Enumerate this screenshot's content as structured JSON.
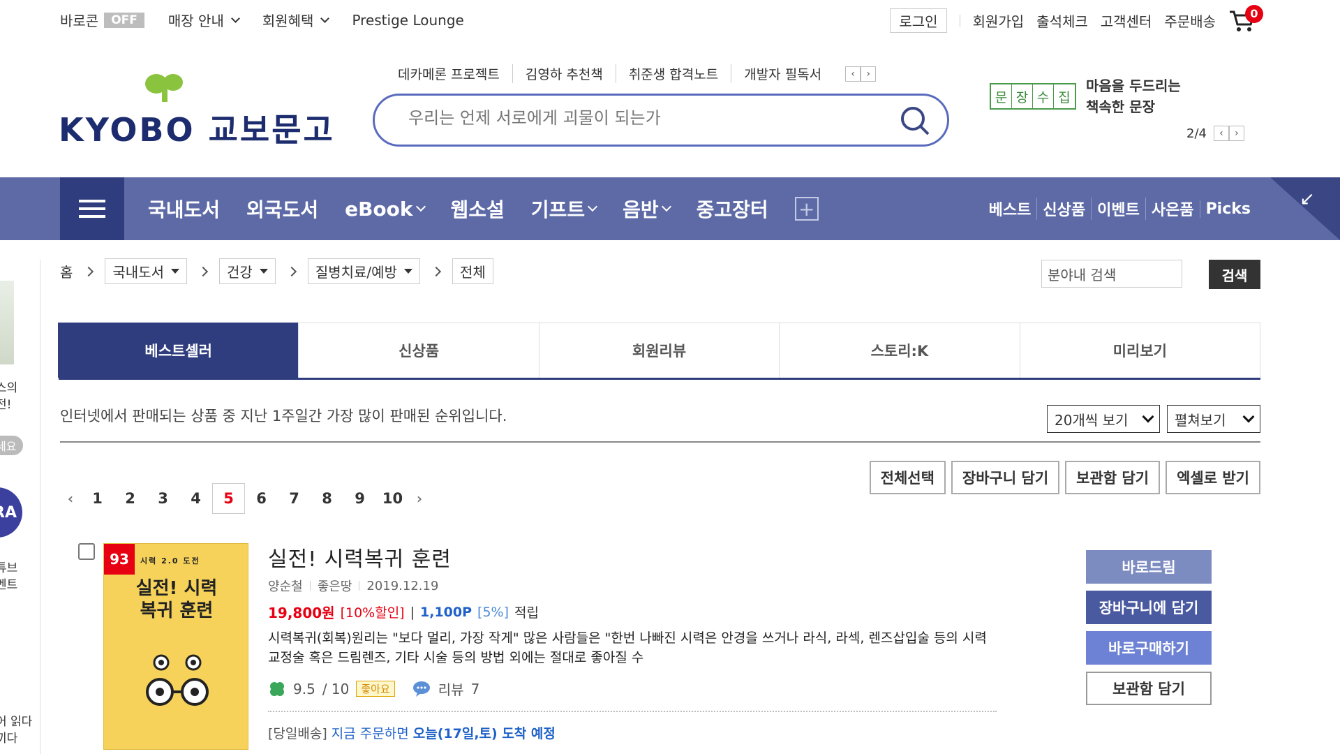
{
  "util": {
    "barocon": "바로콘",
    "barocon_state": "OFF",
    "store_guide": "매장 안내",
    "member_benefit": "회원혜택",
    "prestige": "Prestige Lounge",
    "login": "로그인",
    "join": "회원가입",
    "attendance": "출석체크",
    "customer_center": "고객센터",
    "order_delivery": "주문배송",
    "cart_count": "0"
  },
  "header": {
    "logo_text": "KYOBO 교보문고",
    "quick_links": [
      "데카메론 프로젝트",
      "김영하 추천책",
      "취준생 합격노트",
      "개발자 필독서"
    ],
    "search_placeholder": "우리는 언제 서로에게 괴물이 되는가",
    "promo_stamp": [
      "문",
      "장",
      "수",
      "집"
    ],
    "promo_line1": "마음을 두드리는",
    "promo_line2": "책속한 문장",
    "promo_page": "2/4"
  },
  "gnb": {
    "items": [
      {
        "label": "국내도서",
        "has_dropdown": false
      },
      {
        "label": "외국도서",
        "has_dropdown": false
      },
      {
        "label": "eBook",
        "has_dropdown": true
      },
      {
        "label": "웹소설",
        "has_dropdown": false
      },
      {
        "label": "기프트",
        "has_dropdown": true
      },
      {
        "label": "음반",
        "has_dropdown": true
      },
      {
        "label": "중고장터",
        "has_dropdown": false
      }
    ],
    "right": [
      "베스트",
      "신상품",
      "이벤트",
      "사은품",
      "Picks"
    ]
  },
  "sidebar": {
    "text1": "스의",
    "text2": "전!",
    "pill": "세요",
    "circle": "RA",
    "text3": "튜브",
    "text4": "벤트",
    "text5": "어 읽다",
    "text6": "끼다"
  },
  "breadcrumb": {
    "home": "홈",
    "levels": [
      "국내도서",
      "건강",
      "질병치료/예방"
    ],
    "current": "전체",
    "cat_search_value": "분야내 검색",
    "cat_search_button": "검색"
  },
  "tabs": [
    "베스트셀러",
    "신상품",
    "회원리뷰",
    "스토리:K",
    "미리보기"
  ],
  "list": {
    "description": "인터넷에서 판매되는 상품 중 지난 1주일간 가장 많이 판매된 순위입니다.",
    "per_page": "20개씩 보기",
    "view_mode": "펼쳐보기",
    "pages": [
      "1",
      "2",
      "3",
      "4",
      "5",
      "6",
      "7",
      "8",
      "9",
      "10"
    ],
    "current_page": "5",
    "actions": [
      "전체선택",
      "장바구니 담기",
      "보관함 담기",
      "엑셀로 받기"
    ]
  },
  "product": {
    "rank": "93",
    "cover_sub": "시력 2.0 도전",
    "cover_title": "실전! 시력복귀 훈련",
    "title": "실전! 시력복귀 훈련",
    "author": "양순철",
    "publisher": "좋은땅",
    "date": "2019.12.19",
    "price": "19,800원",
    "discount": "[10%할인]",
    "points": "1,100P",
    "points_pct": "[5%]",
    "points_suffix": "적립",
    "description": "시력복귀(회복)원리는 \"보다 멀리, 가장 작게\" 많은 사람들은 \"한번 나빠진 시력은 안경을 쓰거나 라식, 라섹, 렌즈삽입술 등의 시력교정술 혹은 드림렌즈, 기타 시술 등의 방법 외에는 절대로 좋아질 수",
    "rating": "9.5",
    "rating_max": "/ 10",
    "good_badge": "좋아요",
    "review_label": "리뷰",
    "review_count": "7",
    "ship_tag": "[당일배송]",
    "ship_text": "지금 주문하면",
    "ship_eta": "오늘(17일,토) 도착 예정",
    "buttons": [
      "바로드림",
      "장바구니에 담기",
      "바로구매하기",
      "보관함 담기"
    ]
  },
  "colors": {
    "brand_navy": "#2f3c7e",
    "gnb_bg": "#5d6aa6",
    "accent_red": "#e60012",
    "point_blue": "#1e61c8"
  }
}
